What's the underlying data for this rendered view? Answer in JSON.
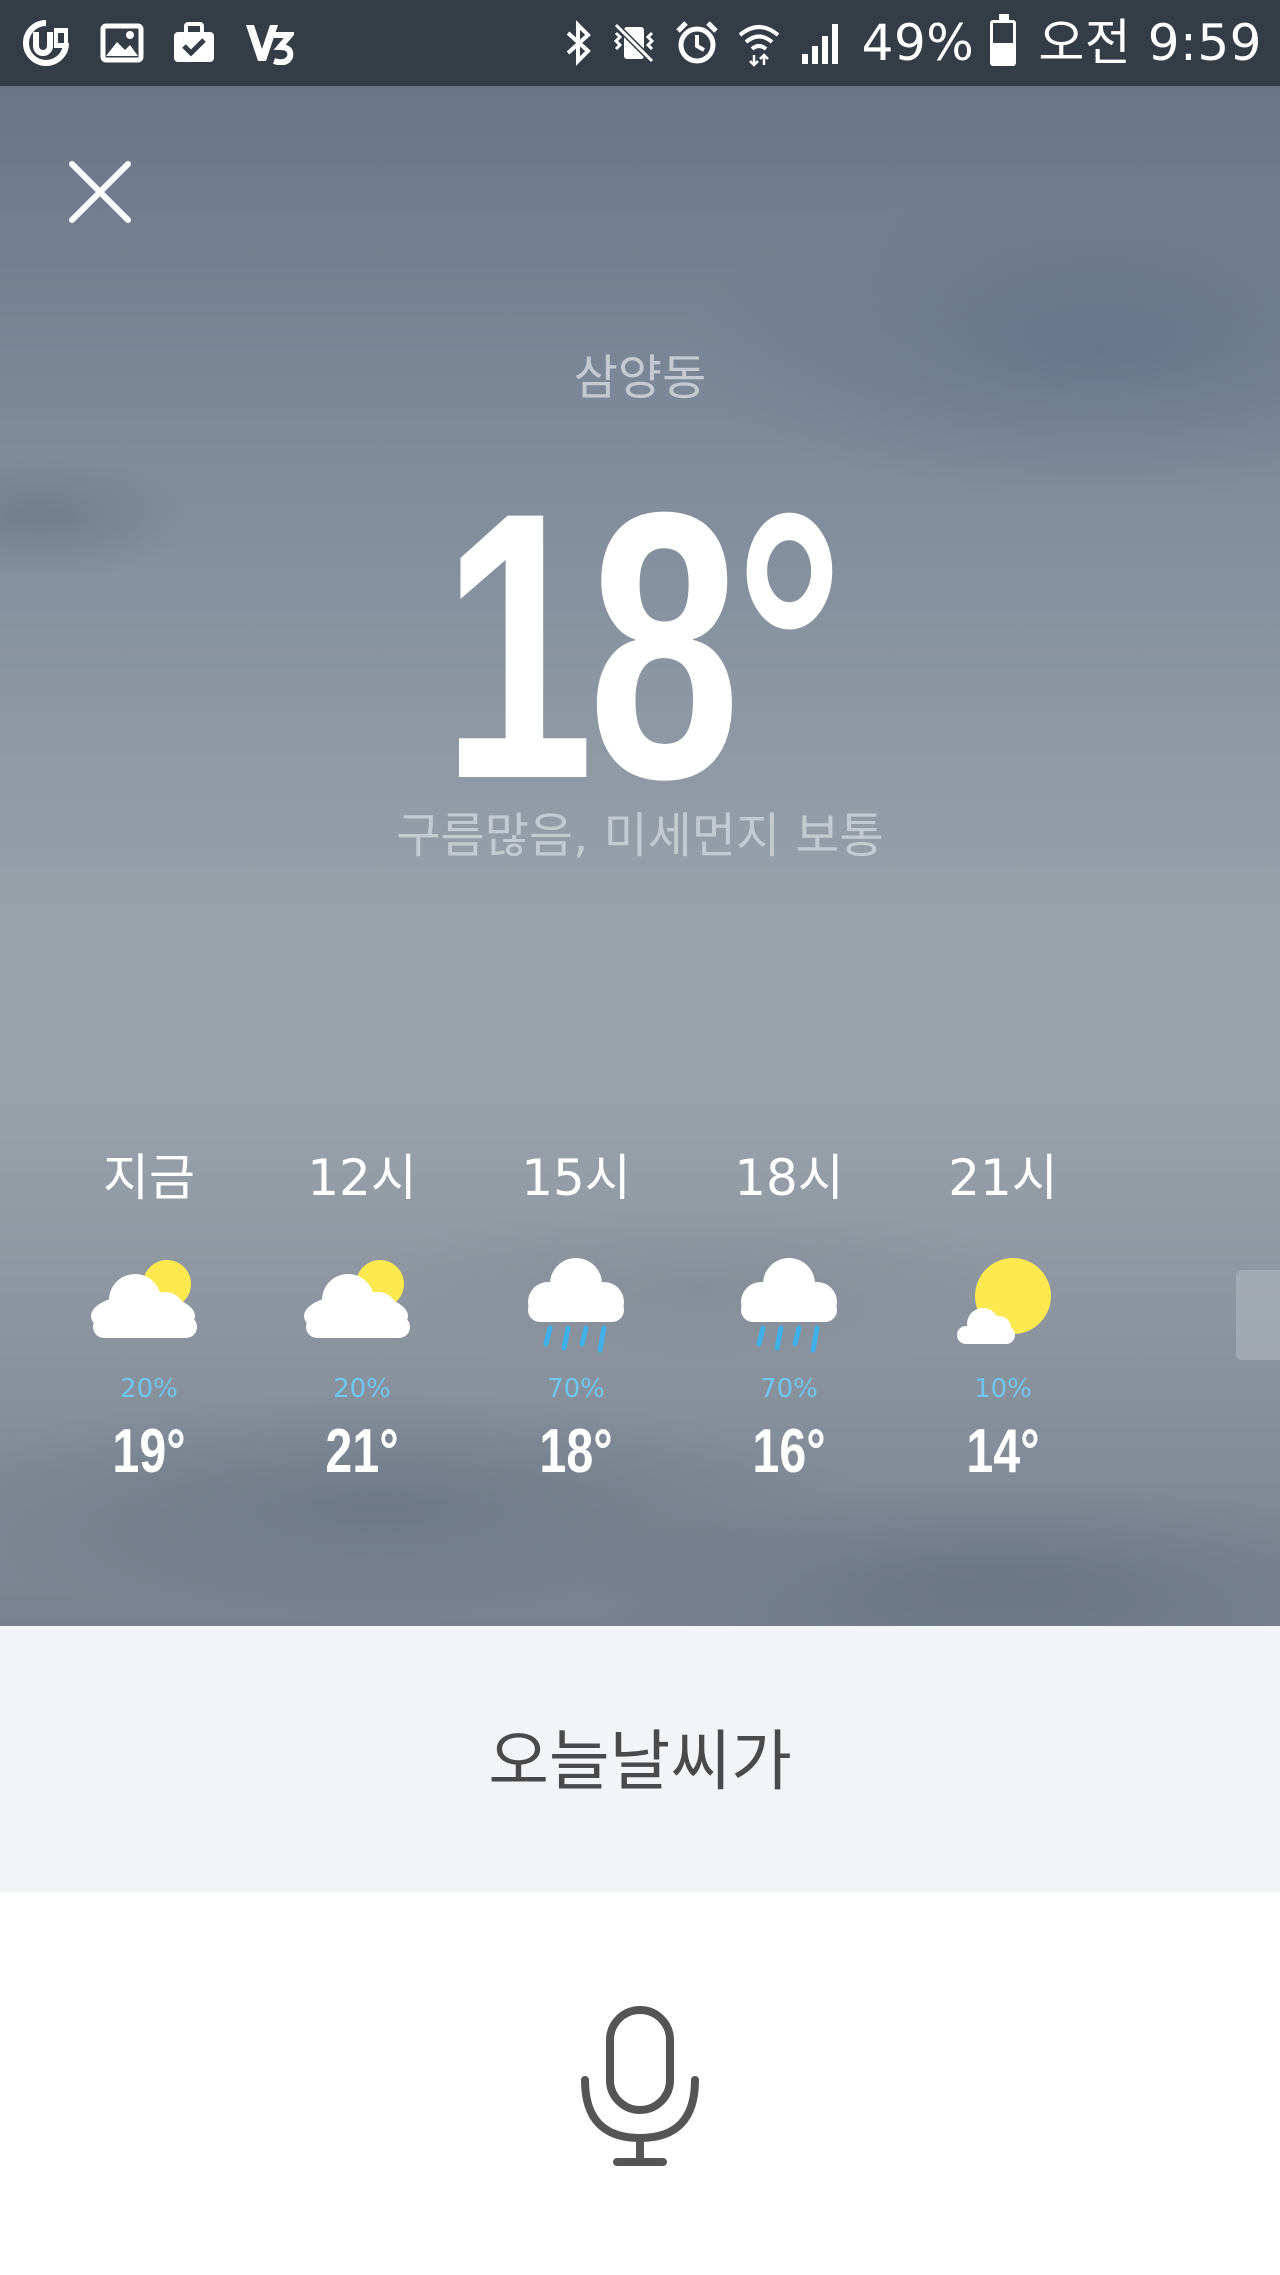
{
  "status_bar": {
    "left_icons": [
      "u-plus-icon",
      "gallery-icon",
      "briefcase-check-icon",
      "v3-icon"
    ],
    "right_icons": [
      "bluetooth-icon",
      "vibrate-icon",
      "alarm-icon",
      "wifi-icon",
      "signal-icon",
      "battery-icon"
    ],
    "battery_percent": "49%",
    "battery_level": 0.49,
    "time": "오전 9:59"
  },
  "weather": {
    "close_icon": "close-icon",
    "location": "삼양동",
    "temperature": "18°",
    "condition": "구름많음, 미세먼지 보통",
    "hourly": [
      {
        "time": "지금",
        "icon": "cloud-sun-icon",
        "precip": "20%",
        "temp": "19°"
      },
      {
        "time": "12시",
        "icon": "cloud-sun-icon",
        "precip": "20%",
        "temp": "21°"
      },
      {
        "time": "15시",
        "icon": "cloud-rain-icon",
        "precip": "70%",
        "temp": "18°"
      },
      {
        "time": "18시",
        "icon": "cloud-rain-icon",
        "precip": "70%",
        "temp": "16°"
      },
      {
        "time": "21시",
        "icon": "sun-cloud-icon",
        "precip": "10%",
        "temp": "14°"
      }
    ]
  },
  "query": {
    "text": "오늘날씨가"
  },
  "mic": {
    "icon": "microphone-icon"
  },
  "colors": {
    "status_bar_bg": "#343c45",
    "precip_text": "#6fc6ef",
    "query_bg": "#f3f4f6",
    "query_text": "#4a4a4a",
    "sun_yellow": "#fce94f",
    "rain_blue": "#3fb0e8",
    "mic_gray": "#555555"
  }
}
